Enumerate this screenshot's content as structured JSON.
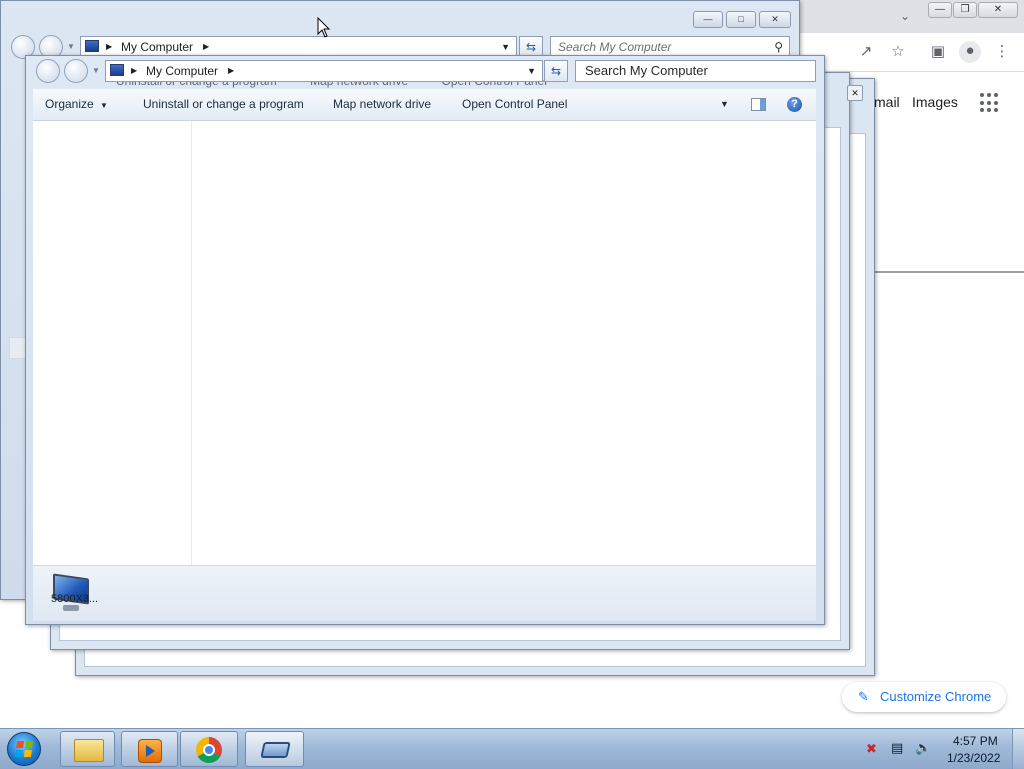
{
  "explorer": {
    "address_text": "My Computer",
    "search_placeholder": "Search My Computer",
    "commands": {
      "organize": "Organize",
      "uninstall": "Uninstall or change a program",
      "map_drive": "Map network drive",
      "control_panel": "Open Control Panel"
    },
    "details_text": "5800X3...",
    "details_suffix": "..."
  },
  "chrome": {
    "links": [
      "mail",
      "Images"
    ],
    "customize_label": "Customize Chrome"
  },
  "taskbar": {
    "clock_time": "4:57 PM",
    "clock_date": "1/23/2022"
  },
  "icons": {
    "help": "?",
    "refresh": "⇆",
    "search": "⚲"
  }
}
